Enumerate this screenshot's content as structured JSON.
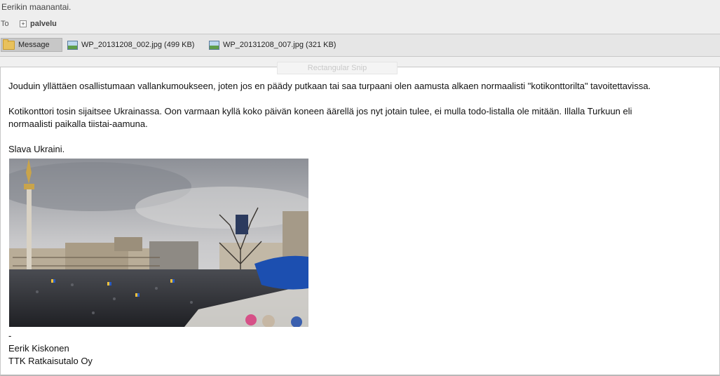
{
  "header": {
    "sender_line": "Eerikin maanantai.",
    "to_label": "To",
    "expand_symbol": "+",
    "recipient": "palvelu"
  },
  "attachments": [
    {
      "label": "Message",
      "icon": "folder-icon"
    },
    {
      "label": "WP_20131208_002.jpg (499 KB)",
      "icon": "image-file-icon"
    },
    {
      "label": "WP_20131208_007.jpg (321 KB)",
      "icon": "image-file-icon"
    }
  ],
  "snip_label": "Rectangular Snip",
  "message": {
    "para1": "Jouduin yllättäen osallistumaan vallankumoukseen, joten jos en päädy putkaan tai saa turpaani olen aamusta alkaen normaalisti \"kotikonttorilta\" tavoitettavissa.",
    "para2_line1": "Kotikonttori tosin sijaitsee Ukrainassa. Oon varmaan kyllä koko päivän koneen äärellä jos nyt jotain tulee, ei mulla  todo-listalla ole mitään. Illalla Turkuun eli",
    "para2_line2": "normaalisti paikalla tiistai-aamuna.",
    "para3": "Slava Ukraini."
  },
  "signature": {
    "dash": "-",
    "name": "Eerik Kiskonen",
    "company": "TTK Ratkaisutalo Oy"
  },
  "colors": {
    "window_bg": "#f0f0f0",
    "attach_bar": "#e6e6e6",
    "selected_attach": "#c7c7c7",
    "flag_blue": "#1c4fb0"
  }
}
